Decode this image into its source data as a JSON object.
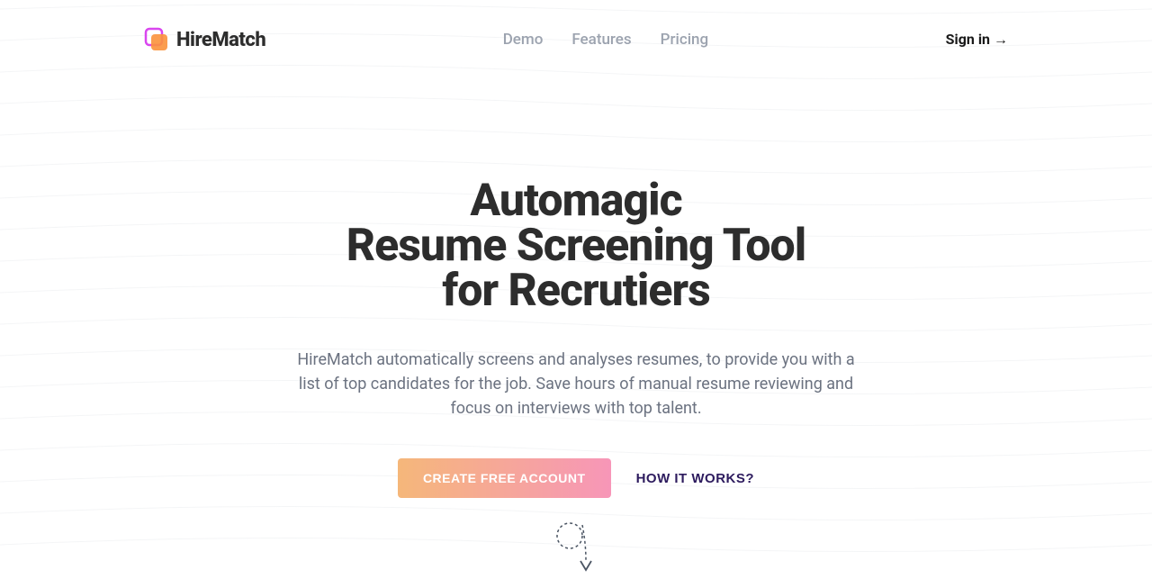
{
  "brand": {
    "name": "HireMatch"
  },
  "nav": {
    "items": [
      {
        "label": "Demo"
      },
      {
        "label": "Features"
      },
      {
        "label": "Pricing"
      }
    ],
    "signIn": "Sign in →"
  },
  "hero": {
    "titleLine1": "Automagic",
    "titleLine2": "Resume Screening Tool",
    "titleLine3": "for Recrutiers",
    "subtitle": "HireMatch automatically screens and analyses resumes, to provide you with a list of top candidates for the job. Save hours of manual resume reviewing and focus on interviews with top talent.",
    "ctaPrimary": "CREATE FREE ACCOUNT",
    "ctaSecondary": "HOW IT WORKS?"
  }
}
